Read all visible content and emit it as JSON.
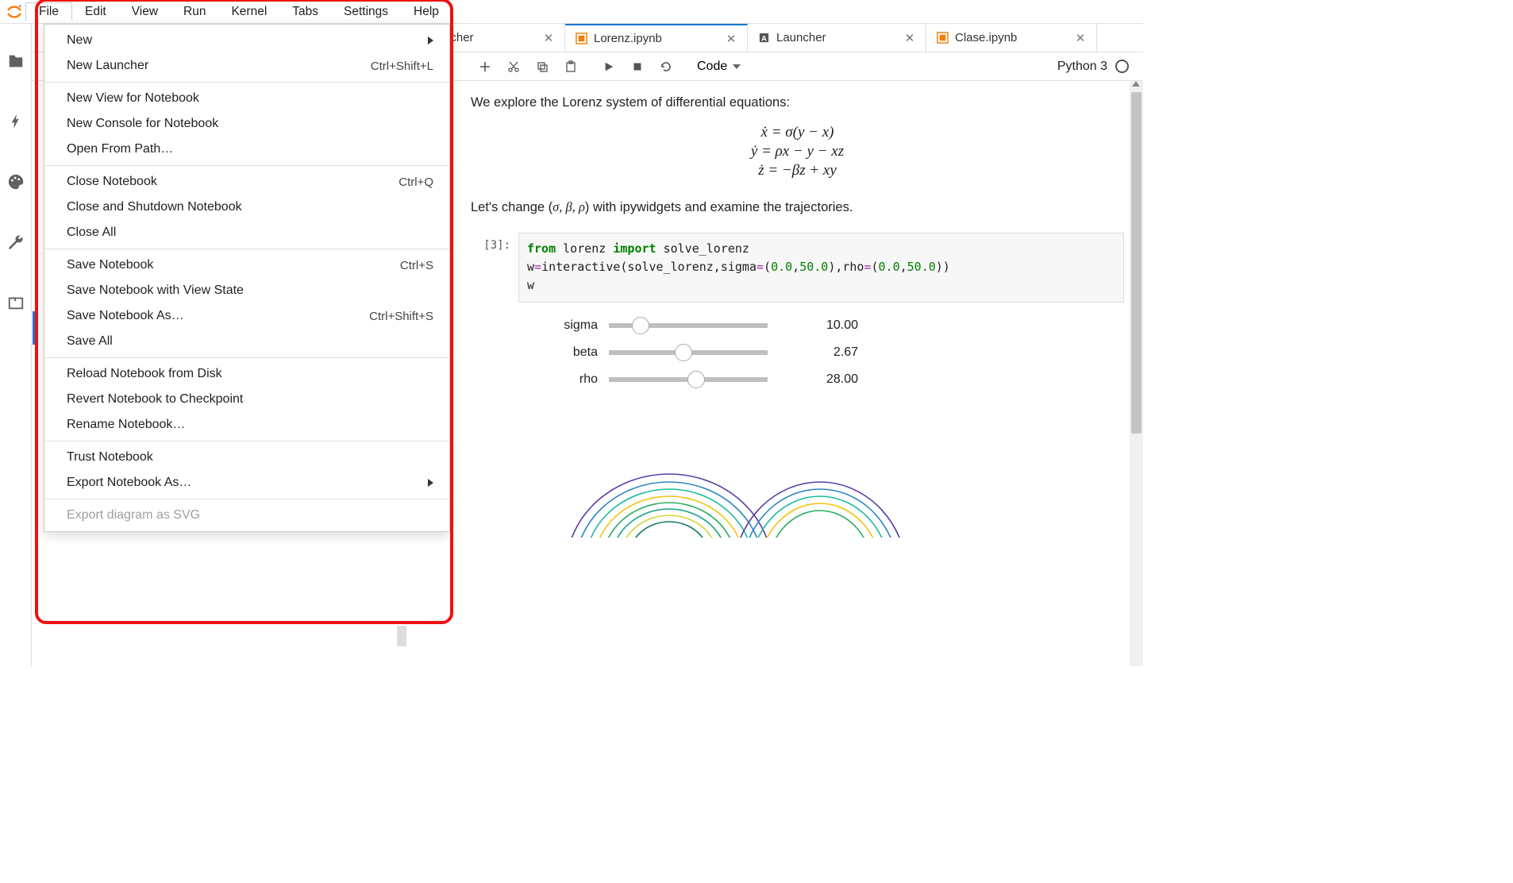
{
  "menubar": {
    "items": [
      "File",
      "Edit",
      "View",
      "Run",
      "Kernel",
      "Tabs",
      "Settings",
      "Help"
    ],
    "active": "File"
  },
  "file_menu": {
    "groups": [
      [
        {
          "label": "New",
          "submenu": true
        },
        {
          "label": "New Launcher",
          "shortcut": "Ctrl+Shift+L"
        }
      ],
      [
        {
          "label": "New View for Notebook"
        },
        {
          "label": "New Console for Notebook"
        },
        {
          "label": "Open From Path…"
        }
      ],
      [
        {
          "label": "Close Notebook",
          "shortcut": "Ctrl+Q"
        },
        {
          "label": "Close and Shutdown Notebook"
        },
        {
          "label": "Close All"
        }
      ],
      [
        {
          "label": "Save Notebook",
          "shortcut": "Ctrl+S"
        },
        {
          "label": "Save Notebook with View State"
        },
        {
          "label": "Save Notebook As…",
          "shortcut": "Ctrl+Shift+S"
        },
        {
          "label": "Save All"
        }
      ],
      [
        {
          "label": "Reload Notebook from Disk"
        },
        {
          "label": "Revert Notebook to Checkpoint"
        },
        {
          "label": "Rename Notebook…"
        }
      ],
      [
        {
          "label": "Trust Notebook"
        },
        {
          "label": "Export Notebook As…",
          "submenu": true
        }
      ],
      [
        {
          "label": "Export diagram as SVG",
          "disabled": true
        }
      ]
    ]
  },
  "tabs": [
    {
      "label": "Launcher",
      "icon": "plus",
      "active": false
    },
    {
      "label": "Lorenz.ipynb",
      "icon": "notebook",
      "active": true
    },
    {
      "label": "Launcher",
      "icon": "text",
      "active": false
    },
    {
      "label": "Clase.ipynb",
      "icon": "notebook",
      "active": false
    }
  ],
  "toolbar": {
    "cell_type": "Code",
    "kernel_name": "Python 3"
  },
  "notebook": {
    "intro": "We explore the Lorenz system of differential equations:",
    "equations": [
      "ẋ = σ(y − x)",
      "ẏ = ρx − y − xz",
      "ż = −βz + xy"
    ],
    "intro2_prefix": "Let's change (",
    "intro2_vars": "σ, β, ρ",
    "intro2_suffix": ") with ipywidgets and examine the trajectories.",
    "code_cell": {
      "prompt": "[3]:",
      "line1_kw1": "from",
      "line1_mod": " lorenz ",
      "line1_kw2": "import",
      "line1_name": " solve_lorenz",
      "line2_a": "w",
      "line2_b": "=",
      "line2_c": "interactive(solve_lorenz,sigma",
      "line2_d": "=",
      "line2_e": "(",
      "line2_f": "0.0",
      "line2_g": ",",
      "line2_h": "50.0",
      "line2_i": "),rho",
      "line2_j": "=",
      "line2_k": "(",
      "line2_l": "0.0",
      "line2_m": ",",
      "line2_n": "50.0",
      "line2_o": "))",
      "line3": "w"
    },
    "widgets": [
      {
        "label": "sigma",
        "value": "10.00",
        "pos": 20
      },
      {
        "label": "beta",
        "value": "2.67",
        "pos": 47
      },
      {
        "label": "rho",
        "value": "28.00",
        "pos": 55
      }
    ]
  }
}
